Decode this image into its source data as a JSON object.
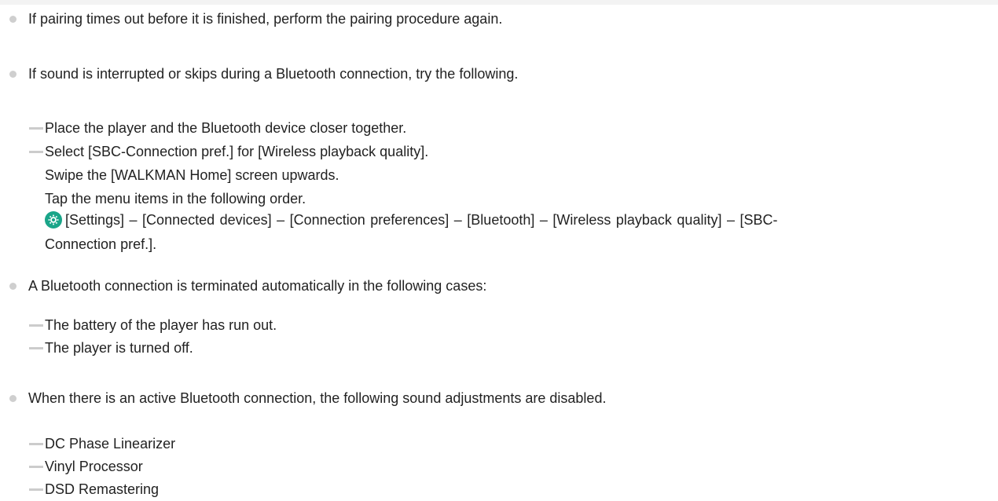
{
  "bullets": [
    {
      "text": "If pairing times out before it is finished, perform the pairing procedure again."
    },
    {
      "text": "If sound is interrupted or skips during a Bluetooth connection, try the following."
    },
    {
      "text": "A Bluetooth connection is terminated automatically in the following cases:"
    },
    {
      "text": "When there is an active Bluetooth connection, the following sound adjustments are disabled."
    }
  ],
  "section2": {
    "items": [
      "Place the player and the Bluetooth device closer together.",
      "Select [SBC-Connection pref.] for [Wireless playback quality]."
    ],
    "steps": [
      "Swipe the [WALKMAN Home] screen upwards.",
      "Tap the menu items in the following order."
    ],
    "menu_path_line1": "[Settings] – [Connected devices] – [Connection preferences] – [Bluetooth] – [Wireless playback quality] – [SBC-",
    "menu_path_line2": "Connection pref.].",
    "settings_icon": "settings-gear-icon",
    "settings_icon_color": "#1aa589"
  },
  "section3": {
    "items": [
      "The battery of the player has run out.",
      "The player is turned off."
    ]
  },
  "section4": {
    "items": [
      "DC Phase Linearizer",
      "Vinyl Processor",
      "DSD Remastering"
    ]
  }
}
